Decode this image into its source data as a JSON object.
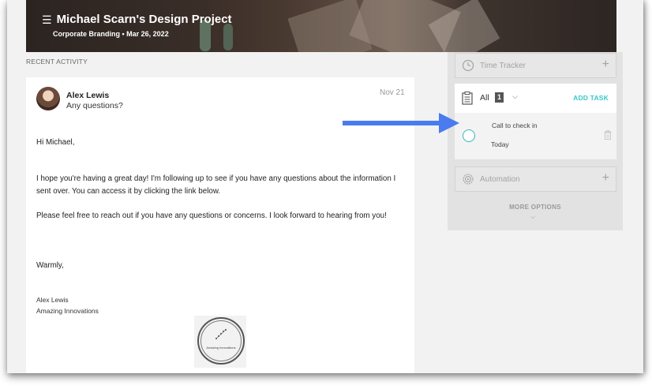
{
  "header": {
    "title": "Michael Scarn's Design Project",
    "subtitle": "Corporate Branding • Mar 26, 2022"
  },
  "activity": {
    "section_label": "RECENT ACTIVITY",
    "message": {
      "sender_name": "Alex Lewis",
      "preview": "Any questions?",
      "date": "Nov 21",
      "greeting": "Hi Michael,",
      "paragraph1": "I hope you're having a great day! I'm following up to see if you have any questions about the information I sent over. You can access it by clicking the link below.",
      "paragraph2": "Please feel free to reach out if you have any questions or concerns. I look forward to hearing from you!",
      "closing": "Warmly,",
      "signature_name": "Alex Lewis",
      "signature_company": "Amazing Innovations",
      "logo_text": "Amazing Innovations"
    }
  },
  "sidebar": {
    "time_tracker_label": "Time Tracker",
    "tasks": {
      "filter_label": "All",
      "count": "1",
      "add_task_label": "ADD TASK",
      "items": [
        {
          "name": "Call to check in",
          "due": "Today"
        }
      ]
    },
    "automation_label": "Automation",
    "more_options_label": "MORE OPTIONS"
  },
  "colors": {
    "accent_teal": "#3cc6c6",
    "arrow_blue": "#4a7cf0"
  }
}
